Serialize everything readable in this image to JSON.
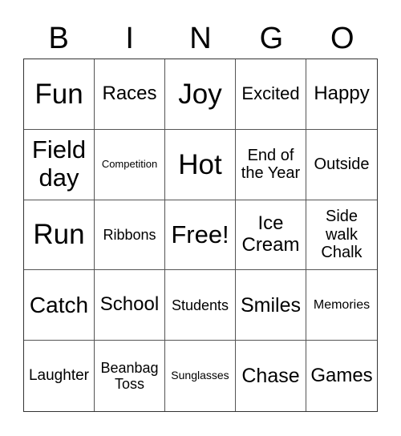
{
  "header": [
    "B",
    "I",
    "N",
    "G",
    "O"
  ],
  "cells": [
    [
      "Fun",
      "Races",
      "Joy",
      "Excited",
      "Happy"
    ],
    [
      "Field day",
      "Competition",
      "Hot",
      "End of the Year",
      "Outside"
    ],
    [
      "Run",
      "Ribbons",
      "Free!",
      "Ice Cream",
      "Side walk Chalk"
    ],
    [
      "Catch",
      "School",
      "Students",
      "Smiles",
      "Memories"
    ],
    [
      "Laughter",
      "Beanbag Toss",
      "Sunglasses",
      "Chase",
      "Games"
    ]
  ]
}
